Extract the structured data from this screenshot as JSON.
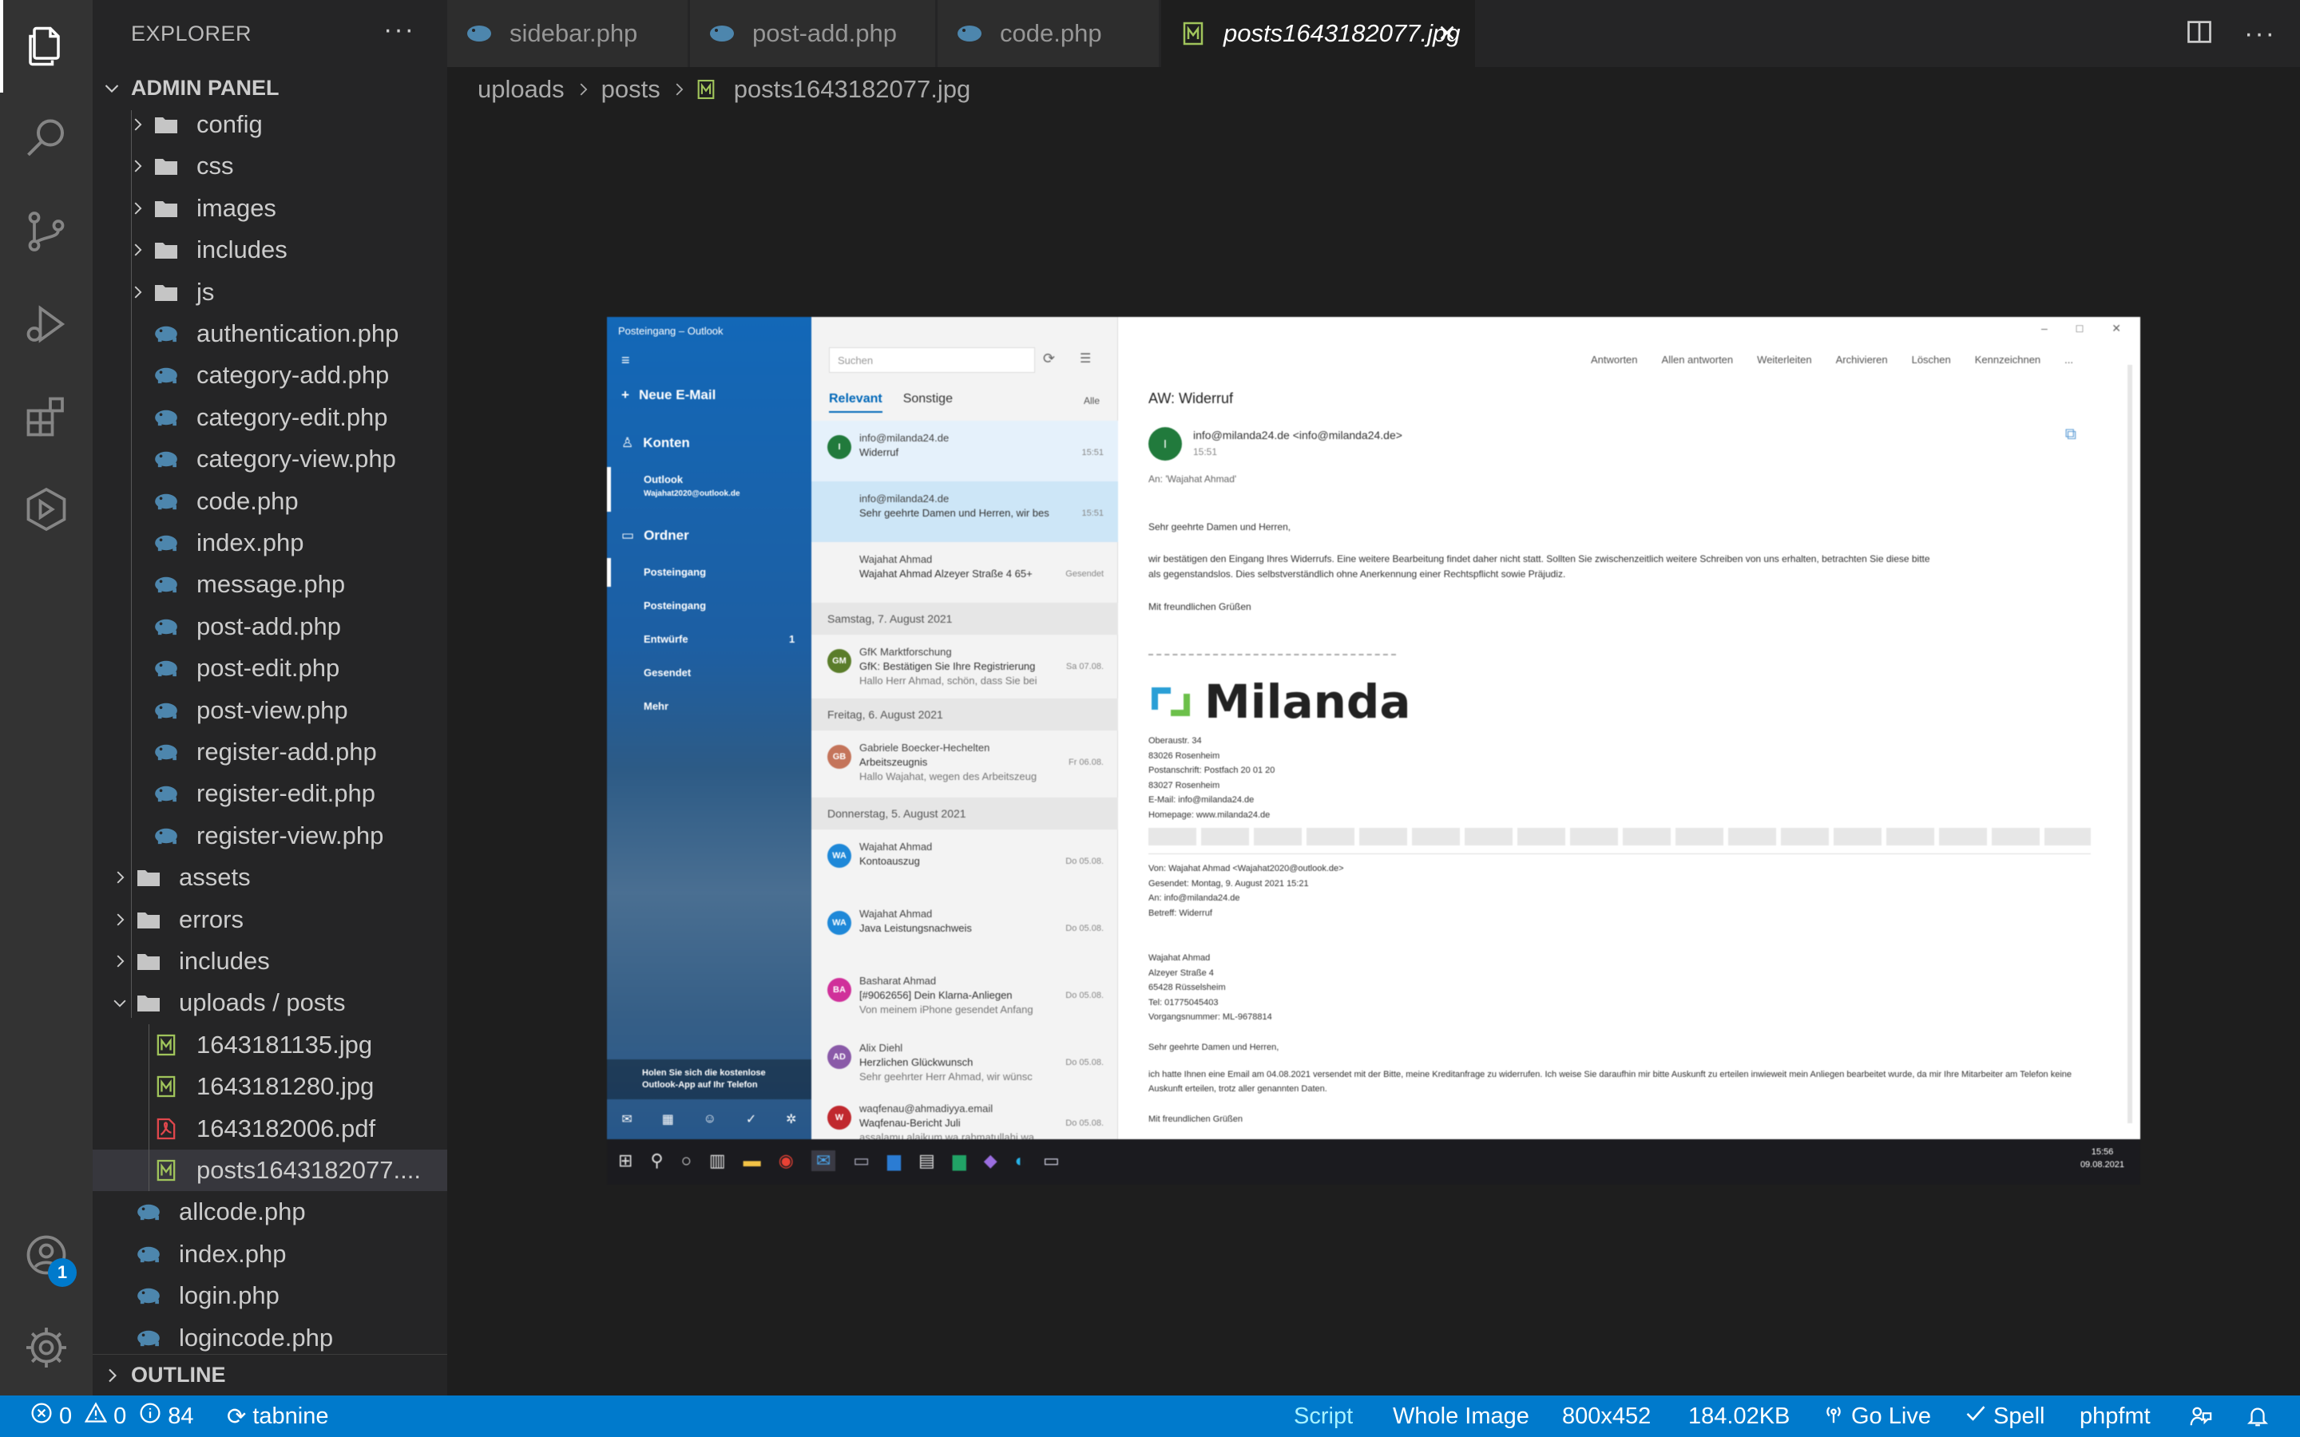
{
  "activity_bar": {
    "items": [
      {
        "name": "files-icon",
        "active": true
      },
      {
        "name": "search-icon"
      },
      {
        "name": "source-control-icon"
      },
      {
        "name": "run-debug-icon"
      },
      {
        "name": "extensions-icon"
      },
      {
        "name": "remote-explorer-icon"
      }
    ],
    "account_badge": "1"
  },
  "sidebar": {
    "title": "EXPLORER",
    "root": "ADMIN PANEL",
    "tree": [
      {
        "label": "config",
        "type": "folder",
        "depth": 1
      },
      {
        "label": "css",
        "type": "folder",
        "depth": 1
      },
      {
        "label": "images",
        "type": "folder",
        "depth": 1
      },
      {
        "label": "includes",
        "type": "folder",
        "depth": 1
      },
      {
        "label": "js",
        "type": "folder",
        "depth": 1
      },
      {
        "label": "authentication.php",
        "type": "php",
        "depth": 1
      },
      {
        "label": "category-add.php",
        "type": "php",
        "depth": 1
      },
      {
        "label": "category-edit.php",
        "type": "php",
        "depth": 1
      },
      {
        "label": "category-view.php",
        "type": "php",
        "depth": 1
      },
      {
        "label": "code.php",
        "type": "php",
        "depth": 1
      },
      {
        "label": "index.php",
        "type": "php",
        "depth": 1
      },
      {
        "label": "message.php",
        "type": "php",
        "depth": 1
      },
      {
        "label": "post-add.php",
        "type": "php",
        "depth": 1
      },
      {
        "label": "post-edit.php",
        "type": "php",
        "depth": 1
      },
      {
        "label": "post-view.php",
        "type": "php",
        "depth": 1
      },
      {
        "label": "register-add.php",
        "type": "php",
        "depth": 1
      },
      {
        "label": "register-edit.php",
        "type": "php",
        "depth": 1
      },
      {
        "label": "register-view.php",
        "type": "php",
        "depth": 1
      },
      {
        "label": "assets",
        "type": "folder",
        "depth": 0
      },
      {
        "label": "errors",
        "type": "folder",
        "depth": 0
      },
      {
        "label": "includes",
        "type": "folder",
        "depth": 0
      },
      {
        "label": "uploads / posts",
        "type": "folder-open",
        "depth": 0
      },
      {
        "label": "1643181135.jpg",
        "type": "img",
        "depth": 1
      },
      {
        "label": "1643181280.jpg",
        "type": "img",
        "depth": 1
      },
      {
        "label": "1643182006.pdf",
        "type": "pdf",
        "depth": 1
      },
      {
        "label": "posts1643182077....",
        "type": "img",
        "depth": 1,
        "selected": true
      },
      {
        "label": "allcode.php",
        "type": "php",
        "depth": 0
      },
      {
        "label": "index.php",
        "type": "php",
        "depth": 0
      },
      {
        "label": "login.php",
        "type": "php",
        "depth": 0
      },
      {
        "label": "logincode.php",
        "type": "php",
        "depth": 0
      }
    ],
    "outline": "OUTLINE"
  },
  "tabs": [
    {
      "label": "sidebar.php",
      "icon": "php-icon"
    },
    {
      "label": "post-add.php",
      "icon": "php-icon"
    },
    {
      "label": "code.php",
      "icon": "php-icon"
    },
    {
      "label": "posts1643182077.jpg",
      "icon": "image-file-icon",
      "active": true
    }
  ],
  "breadcrumb": [
    "uploads",
    "posts",
    "posts1643182077.jpg"
  ],
  "image": {
    "window_title": "Posteingang – Outlook",
    "nav": {
      "new_mail": "Neue E-Mail",
      "accounts": "Konten",
      "account_name": "Outlook",
      "account_email": "Wajahat2020@outlook.de",
      "folders": "Ordner",
      "folder_items": [
        "Posteingang",
        "Posteingang",
        "Entwürfe",
        "Gesendet",
        "Mehr"
      ],
      "drafts_count": "1",
      "tip_line1": "Holen Sie sich die kostenlose",
      "tip_line2": "Outlook-App auf Ihr Telefon"
    },
    "list": {
      "search_placeholder": "Suchen",
      "tab_relevant": "Relevant",
      "tab_other": "Sonstige",
      "filter": "Alle",
      "mails": [
        {
          "avatar": "I",
          "color": "#217a3c",
          "from": "info@milanda24.de",
          "subject": "Widerruf",
          "preview": "",
          "time": "15:51"
        },
        {
          "avatar": "",
          "color": "",
          "from": "info@milanda24.de",
          "subject": "Sehr geehrte Damen und Herren, wir bes",
          "preview": "",
          "time": "15:51"
        },
        {
          "avatar": "",
          "color": "",
          "from": "Wajahat Ahmad",
          "subject": "Wajahat Ahmad Alzeyer Straße 4 65+",
          "preview": "",
          "time": "Gesendet"
        },
        {
          "avatar": "GM",
          "color": "#5a7d2a",
          "from": "GfK Marktforschung",
          "subject": "GfK: Bestätigen Sie Ihre Registrierung",
          "preview": "Hallo Herr Ahmad, schön, dass Sie bei",
          "time": "Sa 07.08."
        },
        {
          "avatar": "GB",
          "color": "#c4745a",
          "from": "Gabriele Boecker-Hechelten",
          "subject": "Arbeitszeugnis",
          "preview": "Hallo Wajahat, wegen des Arbeitszeug",
          "time": "Fr 06.08."
        },
        {
          "avatar": "WA",
          "color": "#1e88d8",
          "from": "Wajahat Ahmad",
          "subject": "Kontoauszug",
          "preview": "",
          "time": "Do 05.08."
        },
        {
          "avatar": "WA",
          "color": "#1e88d8",
          "from": "Wajahat Ahmad",
          "subject": "Java Leistungsnachweis",
          "preview": "",
          "time": "Do 05.08."
        },
        {
          "avatar": "BA",
          "color": "#d0309a",
          "from": "Basharat Ahmad",
          "subject": "[#9062656] Dein Klarna-Anliegen",
          "preview": "Von meinem iPhone gesendet Anfang",
          "time": "Do 05.08."
        },
        {
          "avatar": "AD",
          "color": "#8a5aa8",
          "from": "Alix Diehl",
          "subject": "Herzlichen Glückwunsch",
          "preview": "Sehr geehrter Herr Ahmad, wir wünsc",
          "time": "Do 05.08."
        },
        {
          "avatar": "W",
          "color": "#c0282e",
          "from": "waqfenau@ahmadiyya.email",
          "subject": "Waqfenau-Bericht Juli",
          "preview": "assalamu alaikum wa rahmatullahi wa",
          "time": "Do 05.08."
        }
      ],
      "day_separators": [
        "Samstag, 7. August 2021",
        "Freitag, 6. August 2021",
        "Donnerstag, 5. August 2021"
      ]
    },
    "reading": {
      "actions": [
        "Antworten",
        "Allen antworten",
        "Weiterleiten",
        "Archivieren",
        "Löschen",
        "Kennzeichnen",
        "..."
      ],
      "subject": "AW: Widerruf",
      "from_avatar": "I",
      "from": "info@milanda24.de <info@milanda24.de>",
      "time": "15:51",
      "to": "An: 'Wajahat Ahmad'",
      "greeting": "Sehr geehrte Damen und Herren,",
      "body1": "wir bestätigen den Eingang Ihres Widerrufs. Eine weitere Bearbeitung findet daher nicht statt. Sollten Sie zwischenzeitlich weitere Schreiben von uns erhalten, betrachten Sie diese bitte",
      "body2": "als gegenstandslos. Dies selbstverständlich ohne Anerkennung einer Rechtspflicht sowie Präjudiz.",
      "closing": "Mit freundlichen Grüßen",
      "logo_text": "Milanda",
      "address": [
        "Oberaustr. 34",
        "83026 Rosenheim",
        "Postanschrift: Postfach 20 01 20",
        "83027 Rosenheim",
        "E-Mail: info@milanda24.de",
        "Homepage: www.milanda24.de"
      ],
      "quoted_header": [
        "Von: Wajahat Ahmad <Wajahat2020@outlook.de>",
        "Gesendet: Montag, 9. August 2021 15:21",
        "An: info@milanda24.de",
        "Betreff: Widerruf"
      ],
      "quoted_address": [
        "Wajahat Ahmad",
        "Alzeyer Straße 4",
        "65428 Rüsselsheim",
        "Tel: 01775045403",
        "Vorgangsnummer: ML-9678814"
      ],
      "quoted_greeting": "Sehr geehrte Damen und Herren,",
      "quoted_body": "ich hatte Ihnen eine Email am 04.08.2021 versendet mit der Bitte, meine Kreditanfrage zu widerrufen. Ich weise Sie daraufhin mir bitte Auskunft zu erteilen inwieweit mein Anliegen bearbeitet wurde, da mir Ihre Mitarbeiter am Telefon keine Auskunft erteilen, trotz aller genannten Daten.",
      "quoted_closing": "Mit freundlichen Grüßen"
    },
    "taskbar_time": "15:56",
    "taskbar_date": "09.08.2021"
  },
  "statusbar": {
    "errors": "0",
    "warnings": "0",
    "infos": "84",
    "tabnine": "tabnine",
    "script": "Script",
    "whole_image": "Whole Image",
    "dimensions": "800x452",
    "size": "184.02KB",
    "go_live": "Go Live",
    "spell": "Spell",
    "formatter": "phpfmt"
  },
  "colors": {
    "accent": "#007acc",
    "php_icon": "#4d86ad",
    "image_icon": "#a0c45b",
    "pdf_icon": "#e0474c"
  }
}
